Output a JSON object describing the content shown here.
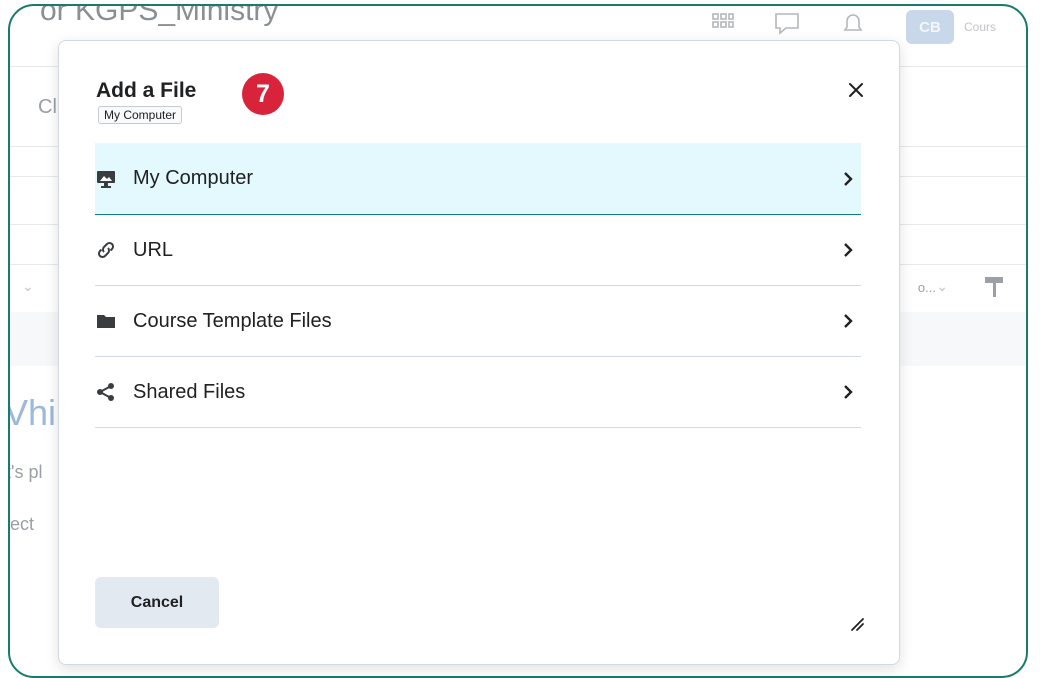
{
  "background": {
    "course_title": "or KGPS_Ministry",
    "avatar_initials": "CB",
    "course_label": "Cours",
    "nav_partial": "Cl",
    "heading_partial": "Vhi",
    "text_line_1": "t's pl",
    "text_line_2": "lect",
    "toolbar_partial": "o..."
  },
  "dialog": {
    "title": "Add a File",
    "step_number": "7",
    "tooltip": "My Computer",
    "close_label": "×",
    "options": [
      {
        "label": "My Computer",
        "icon": "computer-icon",
        "selected": true
      },
      {
        "label": "URL",
        "icon": "link-icon",
        "selected": false
      },
      {
        "label": "Course Template Files",
        "icon": "folder-icon",
        "selected": false
      },
      {
        "label": "Shared Files",
        "icon": "share-icon",
        "selected": false
      }
    ],
    "cancel_label": "Cancel"
  },
  "colors": {
    "frame_border": "#1a7a6e",
    "selected_bg": "#e3f9fd",
    "badge": "#d8233b",
    "cancel_bg": "#e3e9f1"
  }
}
